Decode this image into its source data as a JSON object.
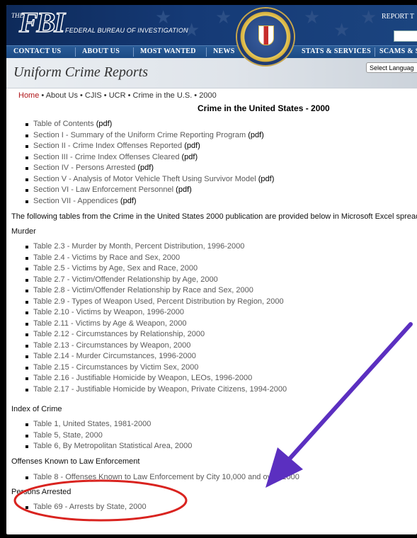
{
  "header": {
    "logo_the": "THE",
    "logo_fbi": "FBI",
    "logo_subtitle": "FEDERAL BUREAU OF INVESTIGATION",
    "report_link": "REPORT T"
  },
  "nav": {
    "items": [
      "CONTACT US",
      "ABOUT US",
      "MOST WANTED",
      "NEWS",
      "STATS & SERVICES",
      "SCAMS & SA"
    ]
  },
  "subheader": {
    "title": "Uniform Crime Reports",
    "language_select": "Select Languag"
  },
  "breadcrumb": {
    "home": "Home",
    "rest": " • About Us • CJIS • UCR • Crime in the U.S. • 2000"
  },
  "page_title": "Crime in the United States - 2000",
  "sections": [
    {
      "label": "Table of Contents",
      "pdf": "(pdf)"
    },
    {
      "label": "Section I - Summary of the Uniform Crime Reporting Program",
      "pdf": "(pdf)"
    },
    {
      "label": "Section II - Crime Index Offenses Reported",
      "pdf": "(pdf)"
    },
    {
      "label": "Section III - Crime Index Offenses Cleared",
      "pdf": "(pdf)"
    },
    {
      "label": "Section IV - Persons Arrested",
      "pdf": "(pdf)"
    },
    {
      "label": "Section V - Analysis of Motor Vehicle Theft Using Survivor Model",
      "pdf": "(pdf)"
    },
    {
      "label": "Section VI - Law Enforcement Personnel",
      "pdf": "(pdf)"
    },
    {
      "label": "Section VII - Appendices",
      "pdf": "(pdf)"
    }
  ],
  "intro_text": "The following tables from the Crime in the United States 2000 publication are provided below in Microsoft Excel spread",
  "groups": [
    {
      "heading": "Murder",
      "items": [
        "Table 2.3 - Murder by Month, Percent Distribution, 1996-2000",
        "Table 2.4 - Victims by Race and Sex, 2000",
        "Table 2.5 - Victims by Age, Sex and Race, 2000",
        "Table 2.7 - Victim/Offender Relationship by Age, 2000",
        "Table 2.8 - Victim/Offender Relationship by Race and Sex, 2000",
        "Table 2.9 - Types of Weapon Used, Percent Distribution by Region, 2000",
        "Table 2.10 - Victims by Weapon, 1996-2000",
        "Table 2.11 - Victims by Age & Weapon, 2000",
        "Table 2.12 - Circumstances by Relationship, 2000",
        "Table 2.13 - Circumstances by Weapon, 2000",
        "Table 2.14 - Murder Circumstances, 1996-2000",
        "Table 2.15 - Circumstances by Victim Sex, 2000",
        "Table 2.16 - Justifiable Homicide by Weapon, LEOs, 1996-2000",
        "Table 2.17 - Justifiable Homicide by Weapon, Private Citizens, 1994-2000"
      ]
    },
    {
      "heading": "Index of Crime",
      "items": [
        "Table 1, United States, 1981-2000",
        "Table 5, State, 2000",
        "Table 6, By Metropolitan Statistical Area, 2000"
      ]
    },
    {
      "heading": "Offenses Known to Law Enforcement",
      "items": [
        "Table 8 - Offenses Known to Law Enforcement by City 10,000 and over, 2000"
      ]
    },
    {
      "heading": "Persons Arrested",
      "items": [
        "Table 69 - Arrests by State, 2000"
      ]
    }
  ],
  "annotation_colors": {
    "arrow": "#5b2fc0",
    "circle": "#d9231f"
  }
}
